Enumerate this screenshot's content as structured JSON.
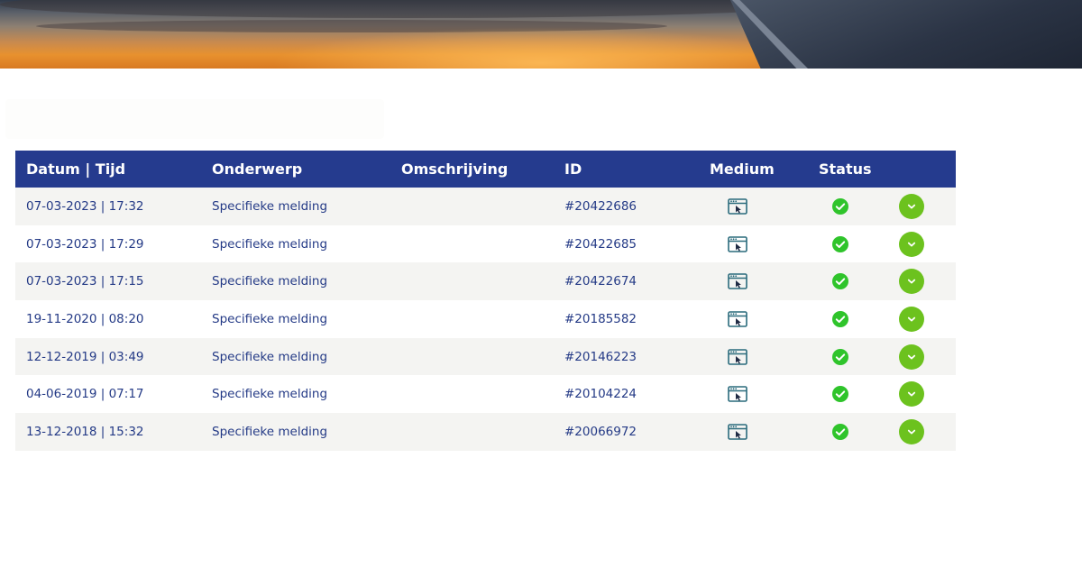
{
  "table": {
    "headers": {
      "date": "Datum | Tijd",
      "subject": "Onderwerp",
      "description": "Omschrijving",
      "id": "ID",
      "medium": "Medium",
      "status": "Status"
    },
    "rows": [
      {
        "date": "07-03-2023 | 17:32",
        "subject": "Specifieke melding",
        "description": "",
        "id": "#20422686",
        "medium_icon": "web-browser-icon",
        "status_icon": "check-circle-icon"
      },
      {
        "date": "07-03-2023 | 17:29",
        "subject": "Specifieke melding",
        "description": "",
        "id": "#20422685",
        "medium_icon": "web-browser-icon",
        "status_icon": "check-circle-icon"
      },
      {
        "date": "07-03-2023 | 17:15",
        "subject": "Specifieke melding",
        "description": "",
        "id": "#20422674",
        "medium_icon": "web-browser-icon",
        "status_icon": "check-circle-icon"
      },
      {
        "date": "19-11-2020 | 08:20",
        "subject": "Specifieke melding",
        "description": "",
        "id": "#20185582",
        "medium_icon": "web-browser-icon",
        "status_icon": "check-circle-icon"
      },
      {
        "date": "12-12-2019 | 03:49",
        "subject": "Specifieke melding",
        "description": "",
        "id": "#20146223",
        "medium_icon": "web-browser-icon",
        "status_icon": "check-circle-icon"
      },
      {
        "date": "04-06-2019 | 07:17",
        "subject": "Specifieke melding",
        "description": "",
        "id": "#20104224",
        "medium_icon": "web-browser-icon",
        "status_icon": "check-circle-icon"
      },
      {
        "date": "13-12-2018 | 15:32",
        "subject": "Specifieke melding",
        "description": "",
        "id": "#20066972",
        "medium_icon": "web-browser-icon",
        "status_icon": "check-circle-icon"
      }
    ]
  },
  "colors": {
    "header_bg": "#253b8e",
    "text": "#243a86",
    "row_alt_bg": "#f4f4f2",
    "status_green": "#2fc42b",
    "expand_green": "#6cc21e",
    "medium_icon": "#2a6b7c"
  }
}
